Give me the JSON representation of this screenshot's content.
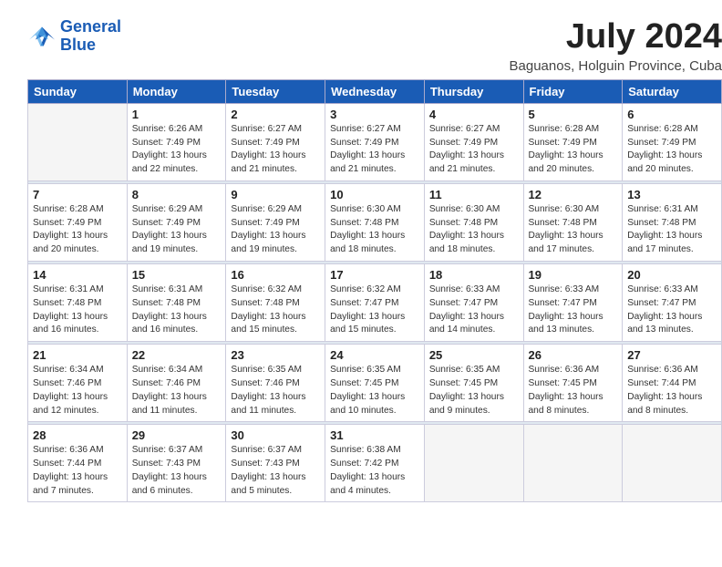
{
  "header": {
    "logo_line1": "General",
    "logo_line2": "Blue",
    "title": "July 2024",
    "location": "Baguanos, Holguin Province, Cuba"
  },
  "weekdays": [
    "Sunday",
    "Monday",
    "Tuesday",
    "Wednesday",
    "Thursday",
    "Friday",
    "Saturday"
  ],
  "weeks": [
    [
      {
        "day": "",
        "empty": true
      },
      {
        "day": "1",
        "sunrise": "6:26 AM",
        "sunset": "7:49 PM",
        "daylight": "13 hours and 22 minutes."
      },
      {
        "day": "2",
        "sunrise": "6:27 AM",
        "sunset": "7:49 PM",
        "daylight": "13 hours and 21 minutes."
      },
      {
        "day": "3",
        "sunrise": "6:27 AM",
        "sunset": "7:49 PM",
        "daylight": "13 hours and 21 minutes."
      },
      {
        "day": "4",
        "sunrise": "6:27 AM",
        "sunset": "7:49 PM",
        "daylight": "13 hours and 21 minutes."
      },
      {
        "day": "5",
        "sunrise": "6:28 AM",
        "sunset": "7:49 PM",
        "daylight": "13 hours and 20 minutes."
      },
      {
        "day": "6",
        "sunrise": "6:28 AM",
        "sunset": "7:49 PM",
        "daylight": "13 hours and 20 minutes."
      }
    ],
    [
      {
        "day": "7",
        "sunrise": "6:28 AM",
        "sunset": "7:49 PM",
        "daylight": "13 hours and 20 minutes."
      },
      {
        "day": "8",
        "sunrise": "6:29 AM",
        "sunset": "7:49 PM",
        "daylight": "13 hours and 19 minutes."
      },
      {
        "day": "9",
        "sunrise": "6:29 AM",
        "sunset": "7:49 PM",
        "daylight": "13 hours and 19 minutes."
      },
      {
        "day": "10",
        "sunrise": "6:30 AM",
        "sunset": "7:48 PM",
        "daylight": "13 hours and 18 minutes."
      },
      {
        "day": "11",
        "sunrise": "6:30 AM",
        "sunset": "7:48 PM",
        "daylight": "13 hours and 18 minutes."
      },
      {
        "day": "12",
        "sunrise": "6:30 AM",
        "sunset": "7:48 PM",
        "daylight": "13 hours and 17 minutes."
      },
      {
        "day": "13",
        "sunrise": "6:31 AM",
        "sunset": "7:48 PM",
        "daylight": "13 hours and 17 minutes."
      }
    ],
    [
      {
        "day": "14",
        "sunrise": "6:31 AM",
        "sunset": "7:48 PM",
        "daylight": "13 hours and 16 minutes."
      },
      {
        "day": "15",
        "sunrise": "6:31 AM",
        "sunset": "7:48 PM",
        "daylight": "13 hours and 16 minutes."
      },
      {
        "day": "16",
        "sunrise": "6:32 AM",
        "sunset": "7:48 PM",
        "daylight": "13 hours and 15 minutes."
      },
      {
        "day": "17",
        "sunrise": "6:32 AM",
        "sunset": "7:47 PM",
        "daylight": "13 hours and 15 minutes."
      },
      {
        "day": "18",
        "sunrise": "6:33 AM",
        "sunset": "7:47 PM",
        "daylight": "13 hours and 14 minutes."
      },
      {
        "day": "19",
        "sunrise": "6:33 AM",
        "sunset": "7:47 PM",
        "daylight": "13 hours and 13 minutes."
      },
      {
        "day": "20",
        "sunrise": "6:33 AM",
        "sunset": "7:47 PM",
        "daylight": "13 hours and 13 minutes."
      }
    ],
    [
      {
        "day": "21",
        "sunrise": "6:34 AM",
        "sunset": "7:46 PM",
        "daylight": "13 hours and 12 minutes."
      },
      {
        "day": "22",
        "sunrise": "6:34 AM",
        "sunset": "7:46 PM",
        "daylight": "13 hours and 11 minutes."
      },
      {
        "day": "23",
        "sunrise": "6:35 AM",
        "sunset": "7:46 PM",
        "daylight": "13 hours and 11 minutes."
      },
      {
        "day": "24",
        "sunrise": "6:35 AM",
        "sunset": "7:45 PM",
        "daylight": "13 hours and 10 minutes."
      },
      {
        "day": "25",
        "sunrise": "6:35 AM",
        "sunset": "7:45 PM",
        "daylight": "13 hours and 9 minutes."
      },
      {
        "day": "26",
        "sunrise": "6:36 AM",
        "sunset": "7:45 PM",
        "daylight": "13 hours and 8 minutes."
      },
      {
        "day": "27",
        "sunrise": "6:36 AM",
        "sunset": "7:44 PM",
        "daylight": "13 hours and 8 minutes."
      }
    ],
    [
      {
        "day": "28",
        "sunrise": "6:36 AM",
        "sunset": "7:44 PM",
        "daylight": "13 hours and 7 minutes."
      },
      {
        "day": "29",
        "sunrise": "6:37 AM",
        "sunset": "7:43 PM",
        "daylight": "13 hours and 6 minutes."
      },
      {
        "day": "30",
        "sunrise": "6:37 AM",
        "sunset": "7:43 PM",
        "daylight": "13 hours and 5 minutes."
      },
      {
        "day": "31",
        "sunrise": "6:38 AM",
        "sunset": "7:42 PM",
        "daylight": "13 hours and 4 minutes."
      },
      {
        "day": "",
        "empty": true
      },
      {
        "day": "",
        "empty": true
      },
      {
        "day": "",
        "empty": true
      }
    ]
  ]
}
